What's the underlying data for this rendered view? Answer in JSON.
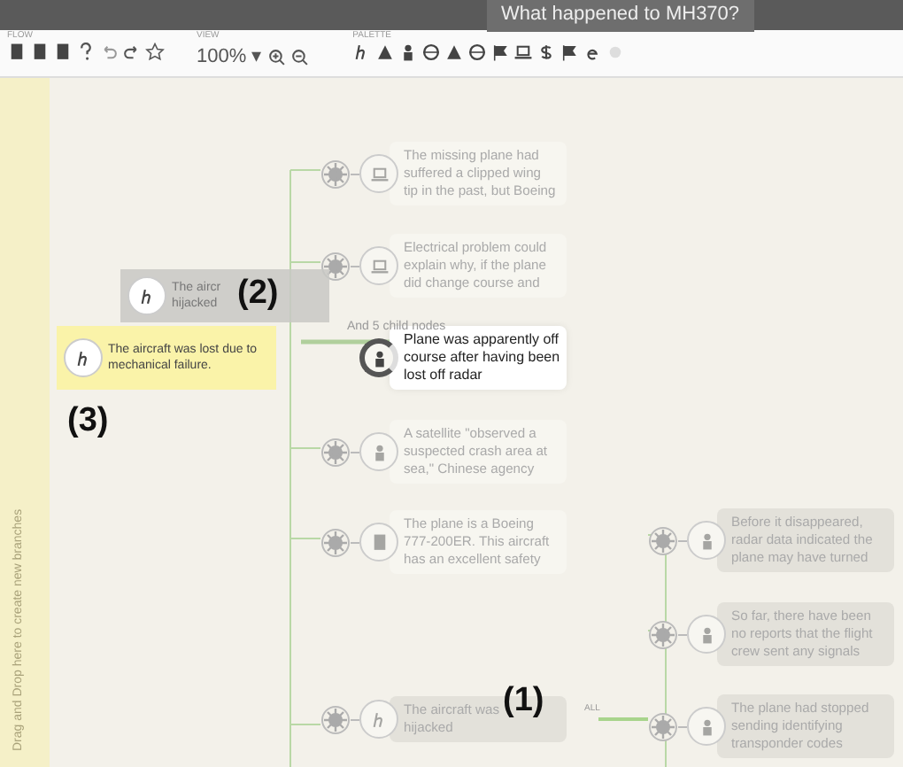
{
  "window": {
    "title": "What happened to MH370?"
  },
  "toolbar": {
    "groups": [
      {
        "label": "FLOW",
        "kind": "flow"
      },
      {
        "label": "VIEW",
        "kind": "view",
        "zoom": "100%",
        "zoom_caret": "▾"
      },
      {
        "label": "PALETTE",
        "kind": "palette"
      }
    ]
  },
  "drop_strip": {
    "text": "Drag and Drop here to create new branches"
  },
  "nodes": [
    {
      "kind": "light",
      "lines": [
        "The missing plane had",
        "suffered a clipped wing",
        "tip in the past, but Boeing"
      ],
      "selected": false
    },
    {
      "kind": "light",
      "lines": [
        "Electrical problem could",
        "explain why, if the plane",
        "did change course and"
      ],
      "selected": false
    },
    {
      "kind": "light",
      "lines": [
        "Plane was apparently off",
        "course after having been",
        "lost off radar"
      ],
      "selected": true
    },
    {
      "kind": "light",
      "lines": [
        "A satellite \"observed a",
        "suspected crash area at",
        "sea,\" Chinese agency"
      ],
      "selected": false
    },
    {
      "kind": "light",
      "lines": [
        "The plane is a Boeing",
        "777-200ER. This aircraft",
        "has an excellent safety"
      ],
      "selected": false
    },
    {
      "kind": "dark",
      "lines": [
        "The aircraft was",
        "hijacked"
      ],
      "selected": false
    },
    {
      "kind": "dark",
      "lines": [
        "Before it disappeared,",
        "radar data indicated the",
        "plane may have turned"
      ],
      "selected": false
    },
    {
      "kind": "dark",
      "lines": [
        "So far, there have been",
        "no reports that the flight",
        "crew sent any signals"
      ],
      "selected": false
    },
    {
      "kind": "dark",
      "lines": [
        "The plane had stopped",
        "sending identifying",
        "transponder codes"
      ],
      "selected": false
    }
  ],
  "child_note": "And 5 child nodes",
  "all_label": "ALL",
  "dragged": [
    {
      "kind": "gray",
      "lines": [
        "The aircr",
        "hijacked"
      ]
    },
    {
      "kind": "yellow",
      "lines": [
        "The aircraft was lost due to",
        "mechanical failure."
      ]
    }
  ],
  "callouts": [
    "(1)",
    "(2)",
    "(3)"
  ]
}
